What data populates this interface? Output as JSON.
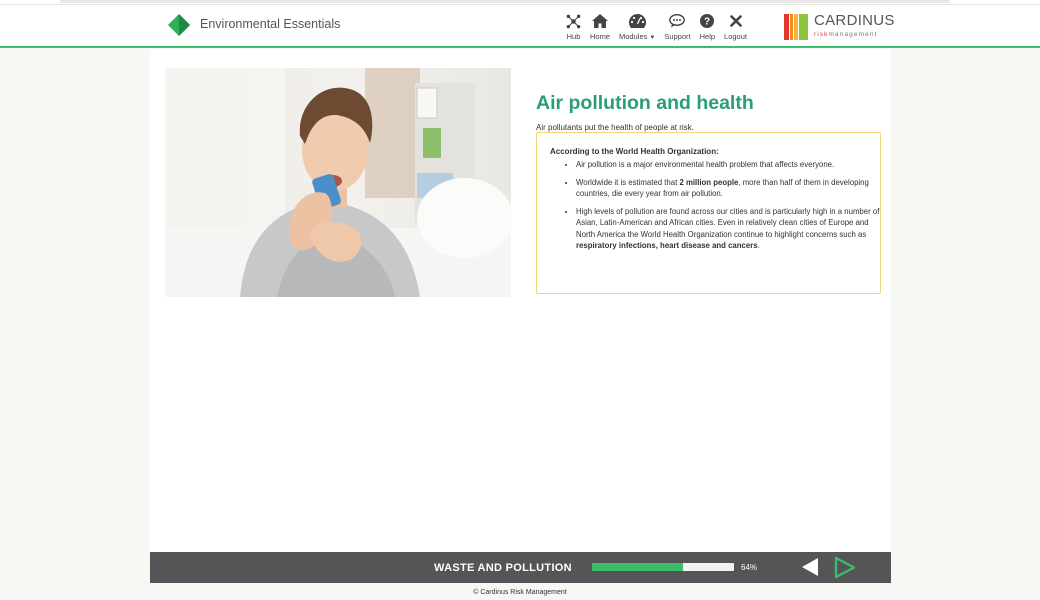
{
  "header": {
    "app_title": "Environmental Essentials",
    "nav": [
      {
        "label": "Hub",
        "icon": "hub-icon"
      },
      {
        "label": "Home",
        "icon": "home-icon"
      },
      {
        "label": "Modules",
        "icon": "dashboard-icon"
      },
      {
        "label": "Support",
        "icon": "chat-icon"
      },
      {
        "label": "Help",
        "icon": "question-icon"
      },
      {
        "label": "Logout",
        "icon": "close-icon"
      }
    ],
    "brand": {
      "name": "CARDINUS",
      "sub_prefix": "risk",
      "sub_rest": "management"
    }
  },
  "main": {
    "photo_alt": "Boy using an asthma inhaler",
    "title": "Air pollution and health",
    "intro": "Air pollutants put the health of people at risk.",
    "callout": {
      "heading": "According to the World Health Organization:",
      "bullet1": "Air pollution is a major environmental health problem that affects everyone.",
      "bullet2_a": "Worldwide it is estimated that ",
      "bullet2_bold": "2 million people",
      "bullet2_b": ", more than half of them in developing countries, die every year from air pollution.",
      "bullet3_a": "High levels of pollution are found across our cities and is particularly high in a number of Asian, Latin-American and African cities. Even in relatively clean cities of Europe and North America the World Health Organization continue to highlight concerns such as ",
      "bullet3_bold": "respiratory infections, heart disease and cancers",
      "bullet3_b": "."
    }
  },
  "footer": {
    "module_name": "WASTE AND POLLUTION",
    "progress_percent": 64,
    "progress_label": "64%",
    "copyright": "© Cardinus Risk Management"
  },
  "colors": {
    "accent_green": "#3dbd6c",
    "title_green": "#2a9f73",
    "callout_border": "#f0d877",
    "footer_bar": "#555557"
  }
}
